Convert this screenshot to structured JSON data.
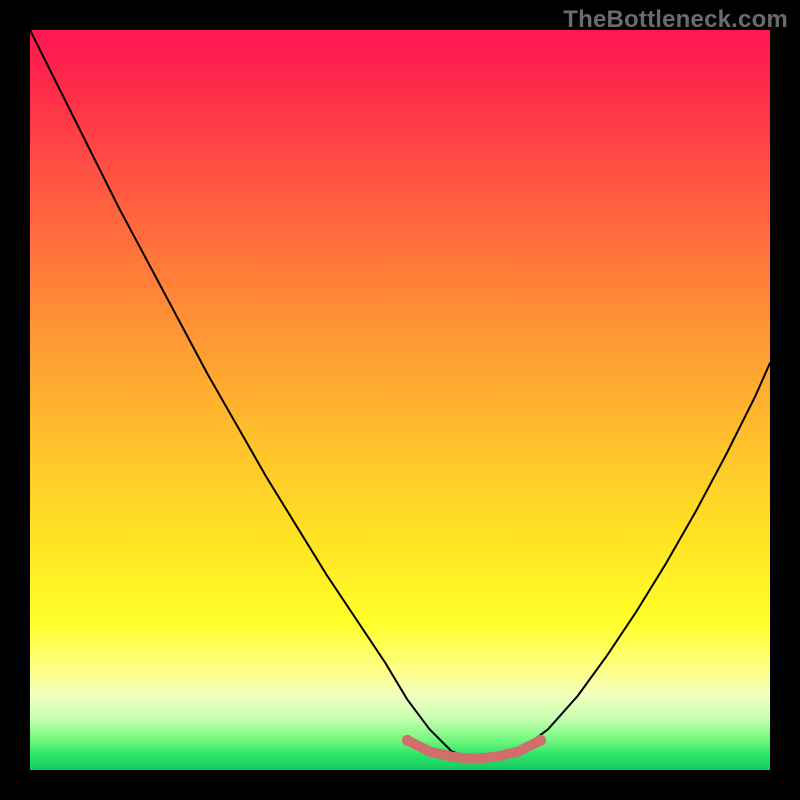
{
  "watermark": {
    "text": "TheBottleneck.com"
  },
  "chart_data": {
    "type": "line",
    "title": "",
    "xlabel": "",
    "ylabel": "",
    "xlim": [
      0,
      100
    ],
    "ylim": [
      0,
      100
    ],
    "grid": false,
    "legend": false,
    "annotations": [],
    "background_gradient_stops": [
      {
        "pos": 0.0,
        "color": "#ff1552"
      },
      {
        "pos": 0.08,
        "color": "#ff2b4a"
      },
      {
        "pos": 0.2,
        "color": "#ff5442"
      },
      {
        "pos": 0.32,
        "color": "#ff7a3a"
      },
      {
        "pos": 0.45,
        "color": "#ffa232"
      },
      {
        "pos": 0.58,
        "color": "#ffc72a"
      },
      {
        "pos": 0.7,
        "color": "#ffe622"
      },
      {
        "pos": 0.8,
        "color": "#ffff2a"
      },
      {
        "pos": 0.86,
        "color": "#feff7f"
      },
      {
        "pos": 0.9,
        "color": "#f2ffbf"
      },
      {
        "pos": 0.93,
        "color": "#c8ffb0"
      },
      {
        "pos": 0.96,
        "color": "#71f77d"
      },
      {
        "pos": 0.98,
        "color": "#2de36a"
      },
      {
        "pos": 1.0,
        "color": "#16c95e"
      }
    ],
    "series": [
      {
        "name": "bottleneck-curve",
        "color": "#000000",
        "width": 2,
        "x": [
          0.0,
          4.0,
          8.0,
          12.0,
          16.0,
          20.0,
          24.0,
          28.0,
          32.0,
          36.0,
          40.0,
          44.0,
          48.0,
          51.0,
          54.0,
          57.0,
          60.0,
          63.0,
          66.0,
          70.0,
          74.0,
          78.0,
          82.0,
          86.0,
          90.0,
          94.0,
          98.0,
          100.0
        ],
        "y": [
          100.0,
          92.0,
          84.0,
          76.0,
          68.5,
          61.0,
          53.5,
          46.5,
          39.5,
          33.0,
          26.5,
          20.5,
          14.5,
          9.5,
          5.5,
          2.5,
          1.5,
          1.5,
          2.5,
          5.5,
          10.0,
          15.5,
          21.5,
          28.0,
          35.0,
          42.5,
          50.5,
          55.0
        ]
      },
      {
        "name": "optimal-band",
        "color": "#cf6e6b",
        "width": 10,
        "x": [
          51.0,
          54.0,
          57.0,
          60.0,
          63.0,
          66.0,
          69.0
        ],
        "y": [
          4.0,
          2.5,
          1.8,
          1.5,
          1.8,
          2.5,
          4.0
        ]
      }
    ]
  }
}
